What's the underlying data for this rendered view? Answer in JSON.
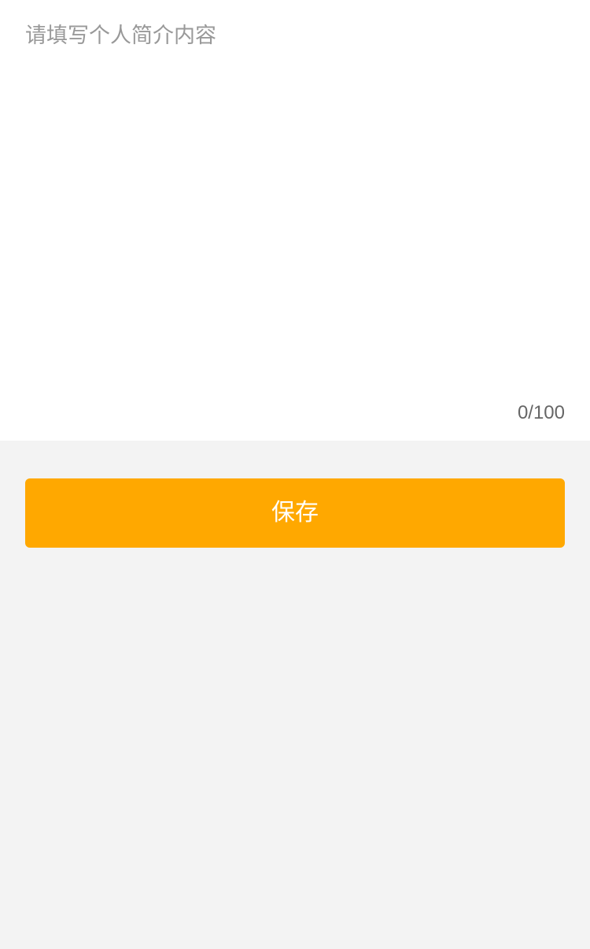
{
  "bio": {
    "value": "",
    "placeholder": "请填写个人简介内容",
    "counter": "0/100"
  },
  "actions": {
    "save_label": "保存"
  },
  "colors": {
    "accent": "#ffa800",
    "background": "#f3f3f3",
    "panel": "#ffffff",
    "placeholder": "#999999",
    "counter": "#666666"
  }
}
